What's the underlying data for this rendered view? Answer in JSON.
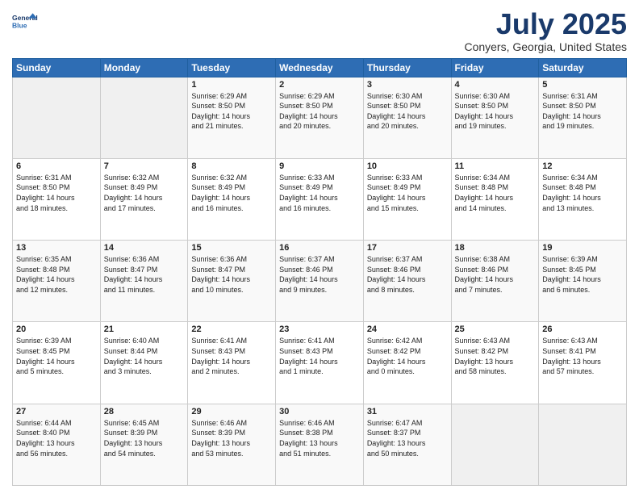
{
  "header": {
    "logo_line1": "General",
    "logo_line2": "Blue",
    "title": "July 2025",
    "subtitle": "Conyers, Georgia, United States"
  },
  "calendar": {
    "days_of_week": [
      "Sunday",
      "Monday",
      "Tuesday",
      "Wednesday",
      "Thursday",
      "Friday",
      "Saturday"
    ],
    "weeks": [
      [
        {
          "day": "",
          "info": ""
        },
        {
          "day": "",
          "info": ""
        },
        {
          "day": "1",
          "info": "Sunrise: 6:29 AM\nSunset: 8:50 PM\nDaylight: 14 hours\nand 21 minutes."
        },
        {
          "day": "2",
          "info": "Sunrise: 6:29 AM\nSunset: 8:50 PM\nDaylight: 14 hours\nand 20 minutes."
        },
        {
          "day": "3",
          "info": "Sunrise: 6:30 AM\nSunset: 8:50 PM\nDaylight: 14 hours\nand 20 minutes."
        },
        {
          "day": "4",
          "info": "Sunrise: 6:30 AM\nSunset: 8:50 PM\nDaylight: 14 hours\nand 19 minutes."
        },
        {
          "day": "5",
          "info": "Sunrise: 6:31 AM\nSunset: 8:50 PM\nDaylight: 14 hours\nand 19 minutes."
        }
      ],
      [
        {
          "day": "6",
          "info": "Sunrise: 6:31 AM\nSunset: 8:50 PM\nDaylight: 14 hours\nand 18 minutes."
        },
        {
          "day": "7",
          "info": "Sunrise: 6:32 AM\nSunset: 8:49 PM\nDaylight: 14 hours\nand 17 minutes."
        },
        {
          "day": "8",
          "info": "Sunrise: 6:32 AM\nSunset: 8:49 PM\nDaylight: 14 hours\nand 16 minutes."
        },
        {
          "day": "9",
          "info": "Sunrise: 6:33 AM\nSunset: 8:49 PM\nDaylight: 14 hours\nand 16 minutes."
        },
        {
          "day": "10",
          "info": "Sunrise: 6:33 AM\nSunset: 8:49 PM\nDaylight: 14 hours\nand 15 minutes."
        },
        {
          "day": "11",
          "info": "Sunrise: 6:34 AM\nSunset: 8:48 PM\nDaylight: 14 hours\nand 14 minutes."
        },
        {
          "day": "12",
          "info": "Sunrise: 6:34 AM\nSunset: 8:48 PM\nDaylight: 14 hours\nand 13 minutes."
        }
      ],
      [
        {
          "day": "13",
          "info": "Sunrise: 6:35 AM\nSunset: 8:48 PM\nDaylight: 14 hours\nand 12 minutes."
        },
        {
          "day": "14",
          "info": "Sunrise: 6:36 AM\nSunset: 8:47 PM\nDaylight: 14 hours\nand 11 minutes."
        },
        {
          "day": "15",
          "info": "Sunrise: 6:36 AM\nSunset: 8:47 PM\nDaylight: 14 hours\nand 10 minutes."
        },
        {
          "day": "16",
          "info": "Sunrise: 6:37 AM\nSunset: 8:46 PM\nDaylight: 14 hours\nand 9 minutes."
        },
        {
          "day": "17",
          "info": "Sunrise: 6:37 AM\nSunset: 8:46 PM\nDaylight: 14 hours\nand 8 minutes."
        },
        {
          "day": "18",
          "info": "Sunrise: 6:38 AM\nSunset: 8:46 PM\nDaylight: 14 hours\nand 7 minutes."
        },
        {
          "day": "19",
          "info": "Sunrise: 6:39 AM\nSunset: 8:45 PM\nDaylight: 14 hours\nand 6 minutes."
        }
      ],
      [
        {
          "day": "20",
          "info": "Sunrise: 6:39 AM\nSunset: 8:45 PM\nDaylight: 14 hours\nand 5 minutes."
        },
        {
          "day": "21",
          "info": "Sunrise: 6:40 AM\nSunset: 8:44 PM\nDaylight: 14 hours\nand 3 minutes."
        },
        {
          "day": "22",
          "info": "Sunrise: 6:41 AM\nSunset: 8:43 PM\nDaylight: 14 hours\nand 2 minutes."
        },
        {
          "day": "23",
          "info": "Sunrise: 6:41 AM\nSunset: 8:43 PM\nDaylight: 14 hours\nand 1 minute."
        },
        {
          "day": "24",
          "info": "Sunrise: 6:42 AM\nSunset: 8:42 PM\nDaylight: 14 hours\nand 0 minutes."
        },
        {
          "day": "25",
          "info": "Sunrise: 6:43 AM\nSunset: 8:42 PM\nDaylight: 13 hours\nand 58 minutes."
        },
        {
          "day": "26",
          "info": "Sunrise: 6:43 AM\nSunset: 8:41 PM\nDaylight: 13 hours\nand 57 minutes."
        }
      ],
      [
        {
          "day": "27",
          "info": "Sunrise: 6:44 AM\nSunset: 8:40 PM\nDaylight: 13 hours\nand 56 minutes."
        },
        {
          "day": "28",
          "info": "Sunrise: 6:45 AM\nSunset: 8:39 PM\nDaylight: 13 hours\nand 54 minutes."
        },
        {
          "day": "29",
          "info": "Sunrise: 6:46 AM\nSunset: 8:39 PM\nDaylight: 13 hours\nand 53 minutes."
        },
        {
          "day": "30",
          "info": "Sunrise: 6:46 AM\nSunset: 8:38 PM\nDaylight: 13 hours\nand 51 minutes."
        },
        {
          "day": "31",
          "info": "Sunrise: 6:47 AM\nSunset: 8:37 PM\nDaylight: 13 hours\nand 50 minutes."
        },
        {
          "day": "",
          "info": ""
        },
        {
          "day": "",
          "info": ""
        }
      ]
    ]
  }
}
